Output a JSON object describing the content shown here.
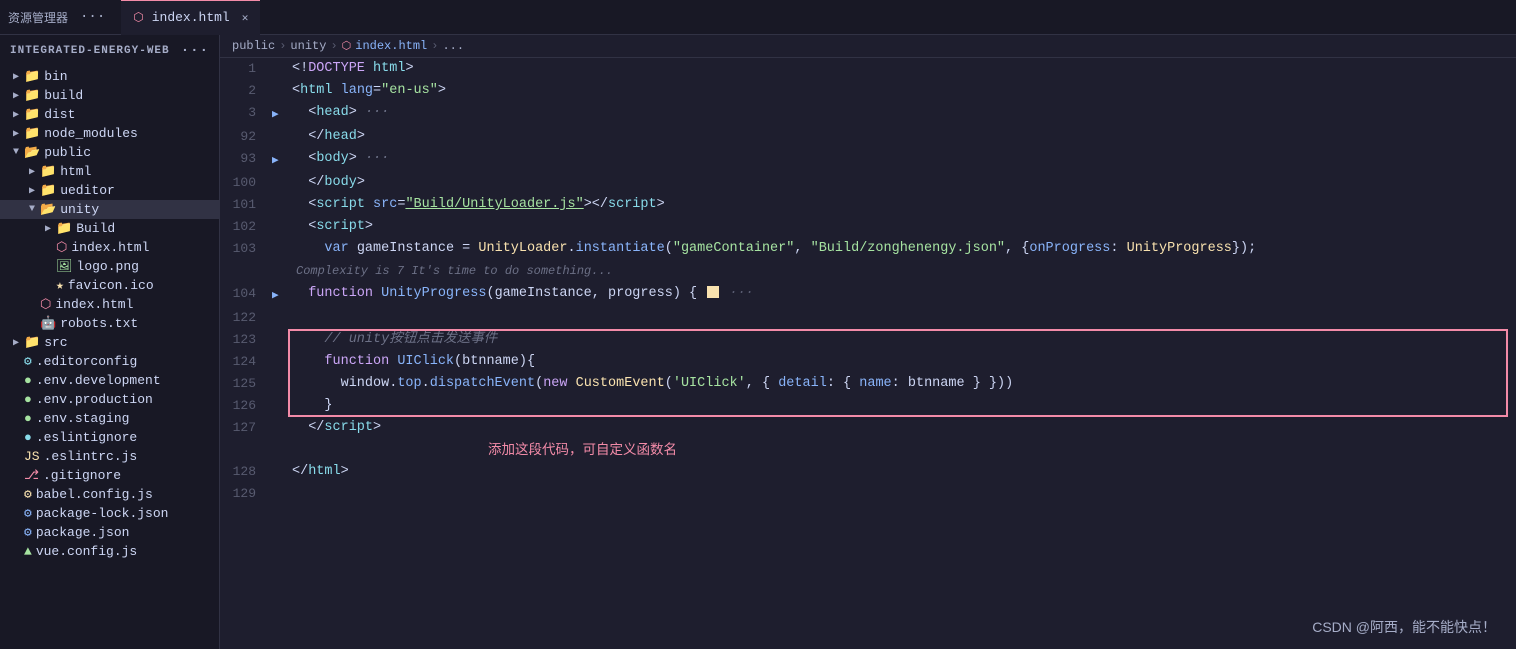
{
  "topbar": {
    "title": "资源管理器",
    "dots": "···",
    "tab": {
      "name": "index.html",
      "close": "✕"
    }
  },
  "breadcrumb": {
    "parts": [
      "public",
      "unity",
      "index.html",
      "..."
    ]
  },
  "sidebar": {
    "header": "INTEGRATED-ENERGY-WEB",
    "dots": "···",
    "items": [
      {
        "id": "bin",
        "label": "bin",
        "type": "folder",
        "depth": 1,
        "collapsed": true
      },
      {
        "id": "build",
        "label": "build",
        "type": "folder",
        "depth": 1,
        "collapsed": true
      },
      {
        "id": "dist",
        "label": "dist",
        "type": "folder",
        "depth": 1,
        "collapsed": true
      },
      {
        "id": "node_modules",
        "label": "node_modules",
        "type": "folder",
        "depth": 1,
        "collapsed": true
      },
      {
        "id": "public",
        "label": "public",
        "type": "folder-open",
        "depth": 1,
        "collapsed": false
      },
      {
        "id": "html",
        "label": "html",
        "type": "folder",
        "depth": 2,
        "collapsed": true
      },
      {
        "id": "ueditor",
        "label": "ueditor",
        "type": "folder",
        "depth": 2,
        "collapsed": true
      },
      {
        "id": "unity",
        "label": "unity",
        "type": "folder-open",
        "depth": 2,
        "collapsed": false
      },
      {
        "id": "Build",
        "label": "Build",
        "type": "folder",
        "depth": 3,
        "collapsed": true
      },
      {
        "id": "index.html",
        "label": "index.html",
        "type": "html",
        "depth": 3
      },
      {
        "id": "logo.png",
        "label": "logo.png",
        "type": "img",
        "depth": 3
      },
      {
        "id": "favicon.ico",
        "label": "favicon.ico",
        "type": "ico",
        "depth": 3
      },
      {
        "id": "index.html2",
        "label": "index.html",
        "type": "html",
        "depth": 2
      },
      {
        "id": "robots.txt",
        "label": "robots.txt",
        "type": "txt",
        "depth": 2
      },
      {
        "id": "src",
        "label": "src",
        "type": "folder",
        "depth": 1,
        "collapsed": true
      },
      {
        "id": ".editorconfig",
        "label": ".editorconfig",
        "type": "config",
        "depth": 1
      },
      {
        "id": ".env.development",
        "label": ".env.development",
        "type": "env",
        "depth": 1
      },
      {
        "id": ".env.production",
        "label": ".env.production",
        "type": "env",
        "depth": 1
      },
      {
        "id": ".env.staging",
        "label": ".env.staging",
        "type": "env",
        "depth": 1
      },
      {
        "id": ".eslintignore",
        "label": ".eslintignore",
        "type": "config",
        "depth": 1
      },
      {
        "id": ".eslintrc.js",
        "label": ".eslintrc.js",
        "type": "js",
        "depth": 1
      },
      {
        "id": ".gitignore",
        "label": ".gitignore",
        "type": "git",
        "depth": 1
      },
      {
        "id": "babel.config.js",
        "label": "babel.config.js",
        "type": "js",
        "depth": 1
      },
      {
        "id": "package-lock.json",
        "label": "package-lock.json",
        "type": "json",
        "depth": 1
      },
      {
        "id": "package.json",
        "label": "package.json",
        "type": "json",
        "depth": 1
      },
      {
        "id": "vue.config.js",
        "label": "vue.config.js",
        "type": "vue",
        "depth": 1
      }
    ]
  },
  "watermark": "CSDN @阿西，能不能快点！"
}
